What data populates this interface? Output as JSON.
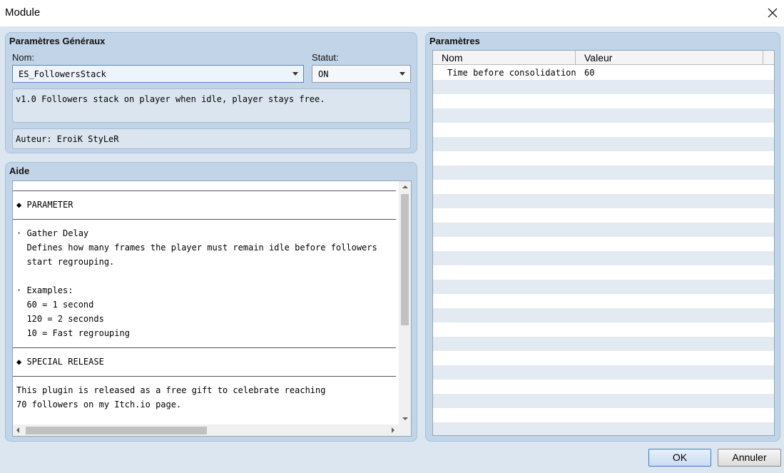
{
  "window": {
    "title": "Module"
  },
  "general": {
    "group_title": "Paramètres Généraux",
    "name_label": "Nom:",
    "name_value": "ES_FollowersStack",
    "status_label": "Statut:",
    "status_value": "ON",
    "description": "v1.0 Followers stack on player when idle, player stays free.",
    "author": "Auteur: EroiK StyLeR"
  },
  "help": {
    "group_title": "Aide",
    "lines": [
      "◆ PARAMETER",
      "· Gather Delay",
      "  Defines how many frames the player must remain idle before followers",
      "  start regrouping.",
      "· Examples:",
      "  60 = 1 second",
      "  120 = 2 seconds",
      "  10 = Fast regrouping",
      "◆ SPECIAL RELEASE",
      "This plugin is released as a free gift to celebrate reaching",
      "70 followers on my Itch.io page."
    ]
  },
  "params": {
    "group_title": "Paramètres",
    "columns": [
      "Nom",
      "Valeur"
    ],
    "rows": [
      {
        "name": "Time before consolidation",
        "value": "60"
      }
    ]
  },
  "buttons": {
    "ok": "OK",
    "cancel": "Annuler"
  },
  "colors": {
    "panel": "#c2d4e7",
    "background": "#dce6f0",
    "row_alt": "#e3eaf2",
    "accent": "#3d7bc4"
  }
}
